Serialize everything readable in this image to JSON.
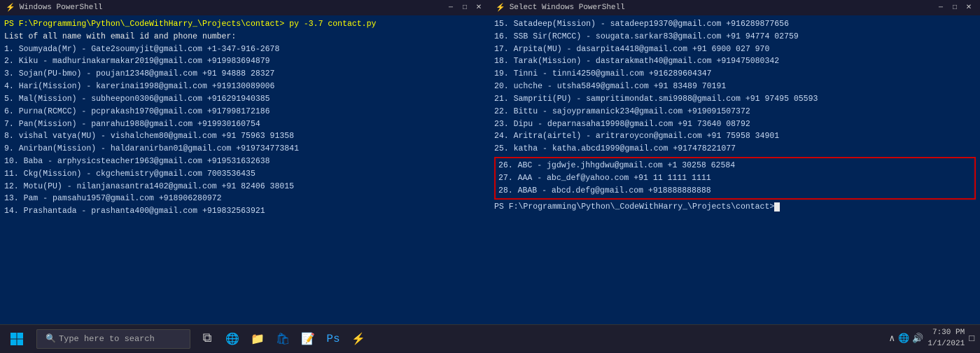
{
  "leftWindow": {
    "title": "Windows PowerShell",
    "cmdLine": "PS F:\\Programming\\Python\\_CodeWithHarry_\\Projects\\contact> py -3.7 contact.py",
    "headerLine": "List of all name with email id and phone number:",
    "entries": [
      "1.  Soumyada(Mr) - Gate2soumyjit@gmail.com            +1-347-916-2678",
      "2.  Kiku - madhurinakarmakar2019@gmail.com           +919983694879",
      "3.  Sojan(PU-bmo) - poujan12348@gmail.com            +91 94888 28327",
      "4.  Hari(Mission) - karerinai1998@gmail.com          +919130089006",
      "5.  Mal(Mission) - subheepon0306@gmail.com           +916291940385",
      "6.  Purna(RCMCC) - pcprakash1970@gmail.com           +917998172186",
      "7.  Pan(Mission) - panrahu1988@gmail.com             +919930160754",
      "8.  vishal vatya(MU) - vishalchem80@gmail.com        +91 75963 91358",
      "9.  Anirban(Mission) - haldaranirban01@gmail.com     +919734773841",
      "10. Baba - arphysicsteacher1963@gmail.com            +919531632638",
      "11. Ckg(Mission) - ckgchemistry@gmail.com            7003536435",
      "12. Motu(PU) - nilanjanasantra1402@gmail.com         +91 82406 38015",
      "13. Pam - pamsahu1957@gmail.com                      +918906280972",
      "14. Prashantada - prashanta400@gmail.com             +919832563921"
    ]
  },
  "rightWindow": {
    "title": "Select Windows PowerShell",
    "entries": [
      "15.  Satadeep(Mission) - satadeep19370@gmail.com      +916289877656",
      "16.  SSB Sir(RCMCC) - sougata.sarkar83@gmail.com      +91 94774 02759",
      "17.  Arpita(MU) - dasarpita4418@gmail.com            +91 6900 027 970",
      "18.  Tarak(Mission) - dastarakmath40@gmail.com       +919475080342",
      "19.  Tinni - tinni4250@gmail.com                     +916289604347",
      "20.  uchche - utsha5849@gmail.com                    +91 83489 70191",
      "21.  Sampriti(PU) - sampritimondat.smi9988@gmail.com  +91 97495 05593",
      "22.  Bittu - sajoypramanick234@gmail.com             +919091507372",
      "23.  Dipu - deparnasaha19998@gmail.com               +91 73640 08792",
      "24.  Aritra(airtel) - aritraroycon@gmail.com         +91 75958 34901",
      "25.  katha - katha.abcd1999@gmail.com                +917478221077"
    ],
    "highlighted": [
      "26.  ABC - jgdwje.jhhgdwu@gmail.com      +1 30258 62584",
      "27.  AAA - abc_def@yahoo.com             +91 11 1111 1111",
      "28.  ABAB - abcd.defg@gmail.com          +918888888888"
    ],
    "promptLine": "PS F:\\Programming\\Python\\_CodeWithHarry_\\Projects\\contact>"
  },
  "taskbar": {
    "searchPlaceholder": "Type here to search",
    "time": "7:30 PM",
    "date": "1/1/2021"
  }
}
